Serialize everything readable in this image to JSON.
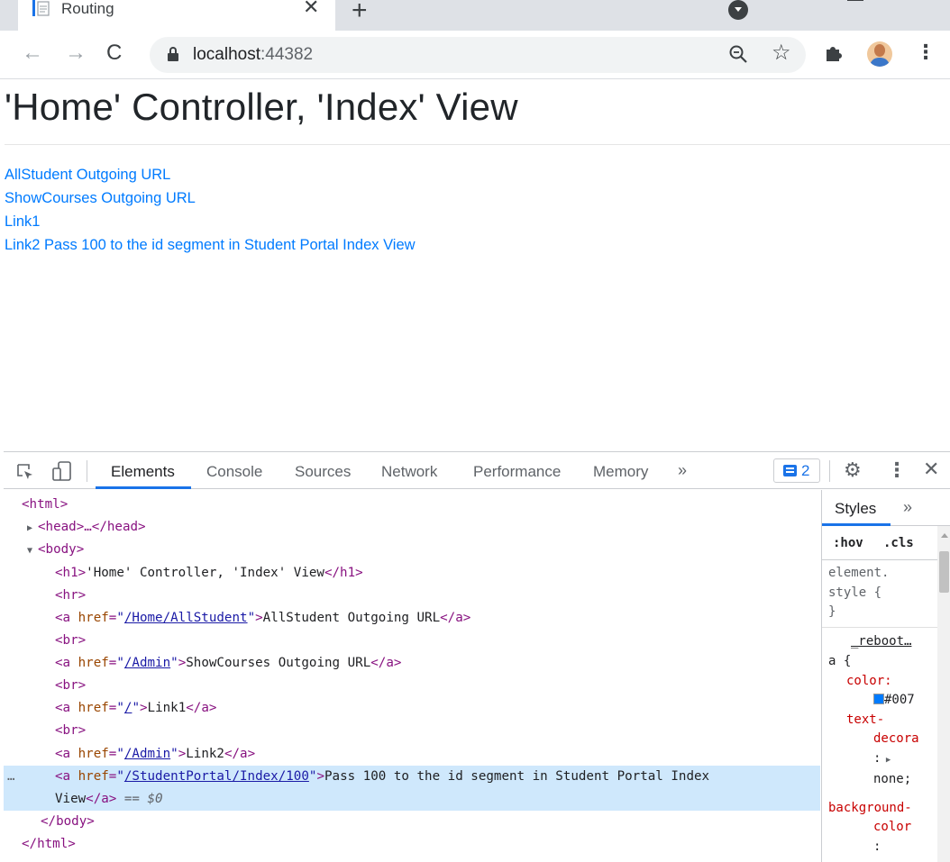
{
  "tab": {
    "title": "Routing",
    "close": "✕"
  },
  "toolbar": {
    "url_host": "localhost",
    "url_port": ":44382"
  },
  "page": {
    "heading": "'Home' Controller, 'Index' View",
    "links": [
      "AllStudent Outgoing URL",
      "ShowCourses Outgoing URL",
      "Link1",
      "Link2 Pass 100 to the id segment in Student Portal Index View"
    ]
  },
  "devtools": {
    "tabs": [
      "Elements",
      "Console",
      "Sources",
      "Network",
      "Performance",
      "Memory"
    ],
    "more": "»",
    "issues_count": "2"
  },
  "dom": {
    "html_open": "<html>",
    "head": "<head>…</head>",
    "body_open": "<body>",
    "h1_open": "<h1>",
    "h1_text": "'Home' Controller, 'Index' View",
    "h1_close": "</h1>",
    "hr": "<hr>",
    "br": "<br>",
    "a_open": "<a ",
    "href_attr": "href",
    "a_close": "</a>",
    "links": [
      {
        "href": "/Home/AllStudent",
        "text": "AllStudent Outgoing URL"
      },
      {
        "href": "/Admin",
        "text": "ShowCourses Outgoing URL"
      },
      {
        "href": "/",
        "text": "Link1"
      },
      {
        "href": "/Admin",
        "text": "Link2"
      },
      {
        "href": "/StudentPortal/Index/100",
        "text": "Pass 100 to the id segment in Student Portal Index",
        "text2": "View"
      }
    ],
    "selected_marker": "== $0",
    "ellipsis": "…",
    "body_close": "</body>",
    "html_close": "</html>"
  },
  "styles": {
    "tab": "Styles",
    "more": "»",
    "hov": ":hov",
    "cls": ".cls",
    "element_style_1": "element.",
    "element_style_2": "style {",
    "close_brace": "}",
    "source": "_reboot…",
    "selector": "a {",
    "prop_color": "color:",
    "color_value": "#007",
    "prop_td1": "text-",
    "prop_td2": "decora",
    "td_colon": ":",
    "td_value": "none;",
    "prop_bg1": "background-",
    "prop_bg2": "color",
    "bg_colon": ":"
  },
  "colors": {
    "link": "#007bff",
    "selection": "#cfe8fc",
    "accent": "#1a73e8"
  }
}
